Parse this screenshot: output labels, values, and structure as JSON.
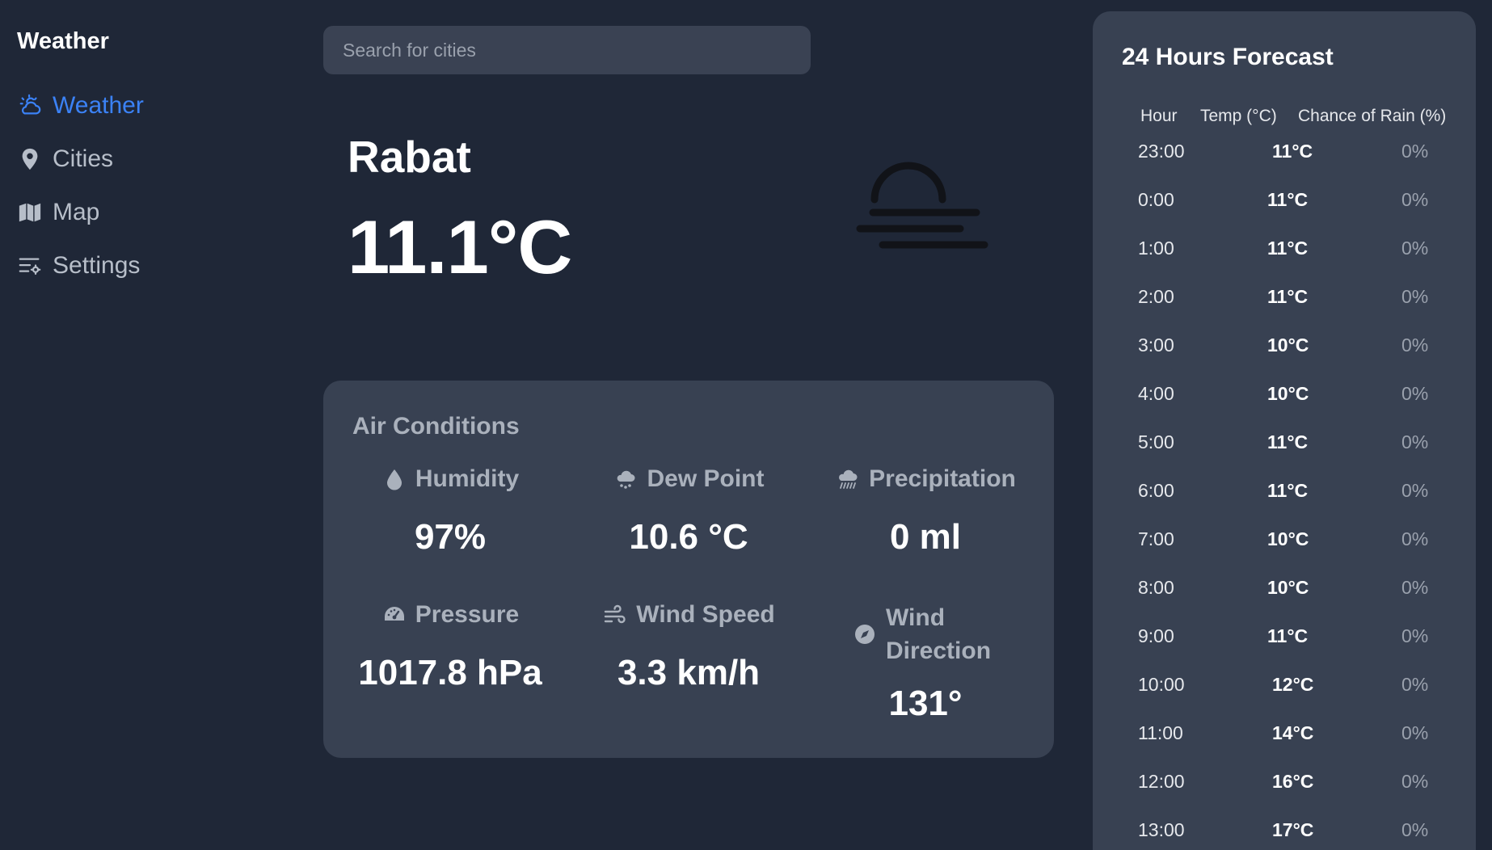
{
  "sidebar": {
    "brand": "Weather",
    "items": [
      {
        "label": "Weather",
        "icon": "weather-icon",
        "active": true
      },
      {
        "label": "Cities",
        "icon": "map-pin-icon",
        "active": false
      },
      {
        "label": "Map",
        "icon": "map-icon",
        "active": false
      },
      {
        "label": "Settings",
        "icon": "settings-icon",
        "active": false
      }
    ]
  },
  "search": {
    "placeholder": "Search for cities",
    "value": ""
  },
  "current": {
    "city": "Rabat",
    "temperature": "11.1°C",
    "condition_icon": "fog-icon"
  },
  "air_conditions": {
    "title": "Air Conditions",
    "metrics": [
      {
        "label": "Humidity",
        "value": "97%",
        "icon": "droplet-icon"
      },
      {
        "label": "Dew Point",
        "value": "10.6 °C",
        "icon": "cloud-rain-icon"
      },
      {
        "label": "Precipitation",
        "value": "0 ml",
        "icon": "cloud-showers-icon"
      },
      {
        "label": "Pressure",
        "value": "1017.8 hPa",
        "icon": "gauge-icon"
      },
      {
        "label": "Wind Speed",
        "value": "3.3 km/h",
        "icon": "wind-icon"
      },
      {
        "label": "Wind Direction",
        "value": "131°",
        "icon": "compass-icon"
      }
    ]
  },
  "forecast": {
    "title": "24 Hours Forecast",
    "columns": [
      "Hour",
      "Temp (°C)",
      "Chance of Rain (%)"
    ],
    "rows": [
      {
        "hour": "23:00",
        "temp": "11°C",
        "rain": "0%"
      },
      {
        "hour": "0:00",
        "temp": "11°C",
        "rain": "0%"
      },
      {
        "hour": "1:00",
        "temp": "11°C",
        "rain": "0%"
      },
      {
        "hour": "2:00",
        "temp": "11°C",
        "rain": "0%"
      },
      {
        "hour": "3:00",
        "temp": "10°C",
        "rain": "0%"
      },
      {
        "hour": "4:00",
        "temp": "10°C",
        "rain": "0%"
      },
      {
        "hour": "5:00",
        "temp": "11°C",
        "rain": "0%"
      },
      {
        "hour": "6:00",
        "temp": "11°C",
        "rain": "0%"
      },
      {
        "hour": "7:00",
        "temp": "10°C",
        "rain": "0%"
      },
      {
        "hour": "8:00",
        "temp": "10°C",
        "rain": "0%"
      },
      {
        "hour": "9:00",
        "temp": "11°C",
        "rain": "0%"
      },
      {
        "hour": "10:00",
        "temp": "12°C",
        "rain": "0%"
      },
      {
        "hour": "11:00",
        "temp": "14°C",
        "rain": "0%"
      },
      {
        "hour": "12:00",
        "temp": "16°C",
        "rain": "0%"
      },
      {
        "hour": "13:00",
        "temp": "17°C",
        "rain": "0%"
      }
    ]
  },
  "colors": {
    "background": "#1f2737",
    "panel": "#384152",
    "accent": "#3b82f6",
    "muted": "#aab1bc"
  }
}
